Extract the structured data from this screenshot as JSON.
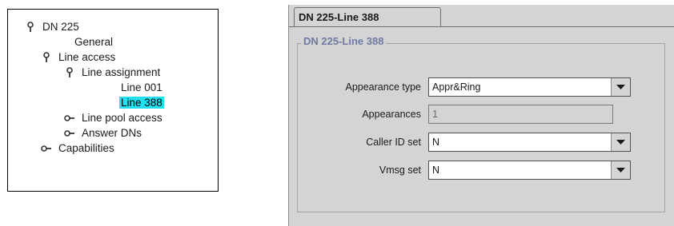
{
  "tree": {
    "nodes": [
      {
        "label": "DN 225",
        "icon": "expanded-node-icon",
        "selected": false
      },
      {
        "label": "General",
        "icon": "",
        "selected": false
      },
      {
        "label": "Line access",
        "icon": "expanded-node-icon",
        "selected": false
      },
      {
        "label": "Line assignment",
        "icon": "expanded-node-icon",
        "selected": false
      },
      {
        "label": "Line 001",
        "icon": "",
        "selected": false
      },
      {
        "label": "Line 388",
        "icon": "",
        "selected": true
      },
      {
        "label": "Line pool access",
        "icon": "collapsed-node-icon",
        "selected": false
      },
      {
        "label": "Answer DNs",
        "icon": "collapsed-node-icon",
        "selected": false
      },
      {
        "label": "Capabilities",
        "icon": "collapsed-node-icon",
        "selected": false
      }
    ],
    "selected_highlight_color": "#22e0f2"
  },
  "dialog": {
    "tab_label": "DN 225-Line 388",
    "group_title": "DN 225-Line 388",
    "fields": {
      "appearance_type": {
        "label": "Appearance type",
        "value": "Appr&Ring"
      },
      "appearances": {
        "label": "Appearances",
        "value": "1"
      },
      "caller_id_set": {
        "label": "Caller ID set",
        "value": "N"
      },
      "vmsg_set": {
        "label": "Vmsg set",
        "value": "N"
      }
    },
    "group_title_color": "#6e7aa0"
  }
}
